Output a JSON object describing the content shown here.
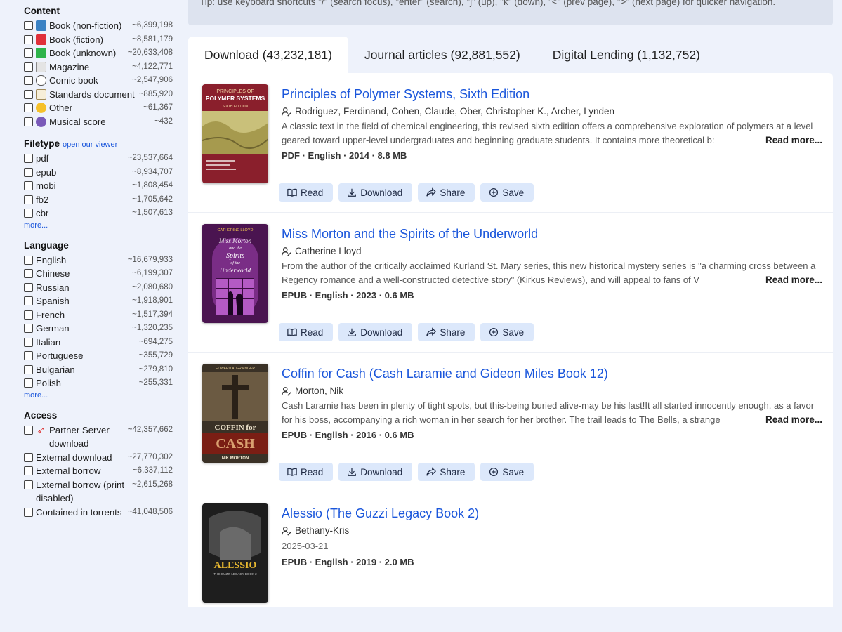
{
  "tip": "Tip: use keyboard shortcuts \"/\" (search focus), \"enter\" (search), \"j\" (up), \"k\" (down), \"<\" (prev page), \">\" (next page) for quicker navigation.",
  "sidebar": {
    "content": {
      "title": "Content",
      "items": [
        {
          "label": "Book (non-fiction)",
          "count": "~6,399,198",
          "icon": "blue-book-icon"
        },
        {
          "label": "Book (fiction)",
          "count": "~8,581,179",
          "icon": "red-book-icon"
        },
        {
          "label": "Book (unknown)",
          "count": "~20,633,408",
          "icon": "green-book-icon"
        },
        {
          "label": "Magazine",
          "count": "~4,122,771",
          "icon": "newspaper-icon"
        },
        {
          "label": "Comic book",
          "count": "~2,547,906",
          "icon": "speech-bubble-icon"
        },
        {
          "label": "Standards document",
          "count": "~885,920",
          "icon": "memo-icon"
        },
        {
          "label": "Other",
          "count": "~61,367",
          "icon": "face-icon"
        },
        {
          "label": "Musical score",
          "count": "~432",
          "icon": "music-notes-icon"
        }
      ]
    },
    "filetype": {
      "title": "Filetype",
      "viewer_link": "open our viewer",
      "items": [
        {
          "label": "pdf",
          "count": "~23,537,664"
        },
        {
          "label": "epub",
          "count": "~8,934,707"
        },
        {
          "label": "mobi",
          "count": "~1,808,454"
        },
        {
          "label": "fb2",
          "count": "~1,705,642"
        },
        {
          "label": "cbr",
          "count": "~1,507,613"
        }
      ],
      "more": "more..."
    },
    "language": {
      "title": "Language",
      "items": [
        {
          "label": "English",
          "count": "~16,679,933"
        },
        {
          "label": "Chinese",
          "count": "~6,199,307"
        },
        {
          "label": "Russian",
          "count": "~2,080,680"
        },
        {
          "label": "Spanish",
          "count": "~1,918,901"
        },
        {
          "label": "French",
          "count": "~1,517,394"
        },
        {
          "label": "German",
          "count": "~1,320,235"
        },
        {
          "label": "Italian",
          "count": "~694,275"
        },
        {
          "label": "Portuguese",
          "count": "~355,729"
        },
        {
          "label": "Bulgarian",
          "count": "~279,810"
        },
        {
          "label": "Polish",
          "count": "~255,331"
        }
      ],
      "more": "more..."
    },
    "access": {
      "title": "Access",
      "items": [
        {
          "label": "Partner Server download",
          "count": "~42,357,662",
          "icon": "rocket-icon"
        },
        {
          "label": "External download",
          "count": "~27,770,302"
        },
        {
          "label": "External borrow",
          "count": "~6,337,112"
        },
        {
          "label": "External borrow (print disabled)",
          "count": "~2,615,268"
        },
        {
          "label": "Contained in torrents",
          "count": "~41,048,506"
        }
      ]
    }
  },
  "tabs": [
    {
      "label": "Download (43,232,181)",
      "active": true
    },
    {
      "label": "Journal articles (92,881,552)",
      "active": false
    },
    {
      "label": "Digital Lending (1,132,752)",
      "active": false
    }
  ],
  "buttons": {
    "read": "Read",
    "download": "Download",
    "share": "Share",
    "save": "Save"
  },
  "read_more": "Read more...",
  "results": [
    {
      "title": "Principles of Polymer Systems, Sixth Edition",
      "author": "Rodriguez, Ferdinand, Cohen, Claude, Ober, Christopher K., Archer, Lynden",
      "description": "A classic text in the field of chemical engineering, this revised sixth edition offers a comprehensive exploration of polymers at a level geared toward upper-level undergraduates and beginning graduate students. It contains more theoretical b:",
      "meta": "PDF · English · 2014 · 8.8 MB",
      "cover": {
        "top_text": "PRINCIPLES OF",
        "main_text": "POLYMER SYSTEMS",
        "sub_text": "SIXTH EDITION",
        "bg": "#8a1f2c"
      }
    },
    {
      "title": "Miss Morton and the Spirits of the Underworld",
      "author": "Catherine Lloyd",
      "description": "From the author of the critically acclaimed Kurland St. Mary series, this new historical mystery series is \"a charming cross between a Regency romance and a well-constructed detective story\" (Kirkus Reviews), and will appeal to fans of V",
      "meta": "EPUB · English · 2023 · 0.6 MB",
      "cover": {
        "top_text": "CATHERINE LLOYD",
        "lines": [
          "Miss Morton",
          "and the",
          "Spirits",
          "of the",
          "Underworld"
        ],
        "bg": "#4a1450"
      }
    },
    {
      "title": "Coffin for Cash (Cash Laramie and Gideon Miles Book 12)",
      "author": "Morton, Nik",
      "description": "Cash Laramie has been in plenty of tight spots, but this-being buried alive-may be his last!It all started innocently enough, as a favor for his boss, accompanying a rich woman in her search for her brother. The trail leads to The Bells, a strange",
      "meta": "EPUB · English · 2016 · 0.6 MB",
      "cover": {
        "top_text": "EDWARD A. GRAINGER",
        "main_text": "COFFIN for",
        "big_text": "CASH",
        "author_text": "NIK MORTON",
        "bg": "#3a3126"
      }
    },
    {
      "title": "Alessio (The Guzzi Legacy Book 2)",
      "author": "Bethany-Kris",
      "date": "2025-03-21",
      "meta": "EPUB · English · 2019 · 2.0 MB",
      "cover": {
        "main_text": "ALESSIO",
        "sub_text": "THE GUZZI LEGACY BOOK 2",
        "bg": "#1e1e1e"
      }
    }
  ]
}
